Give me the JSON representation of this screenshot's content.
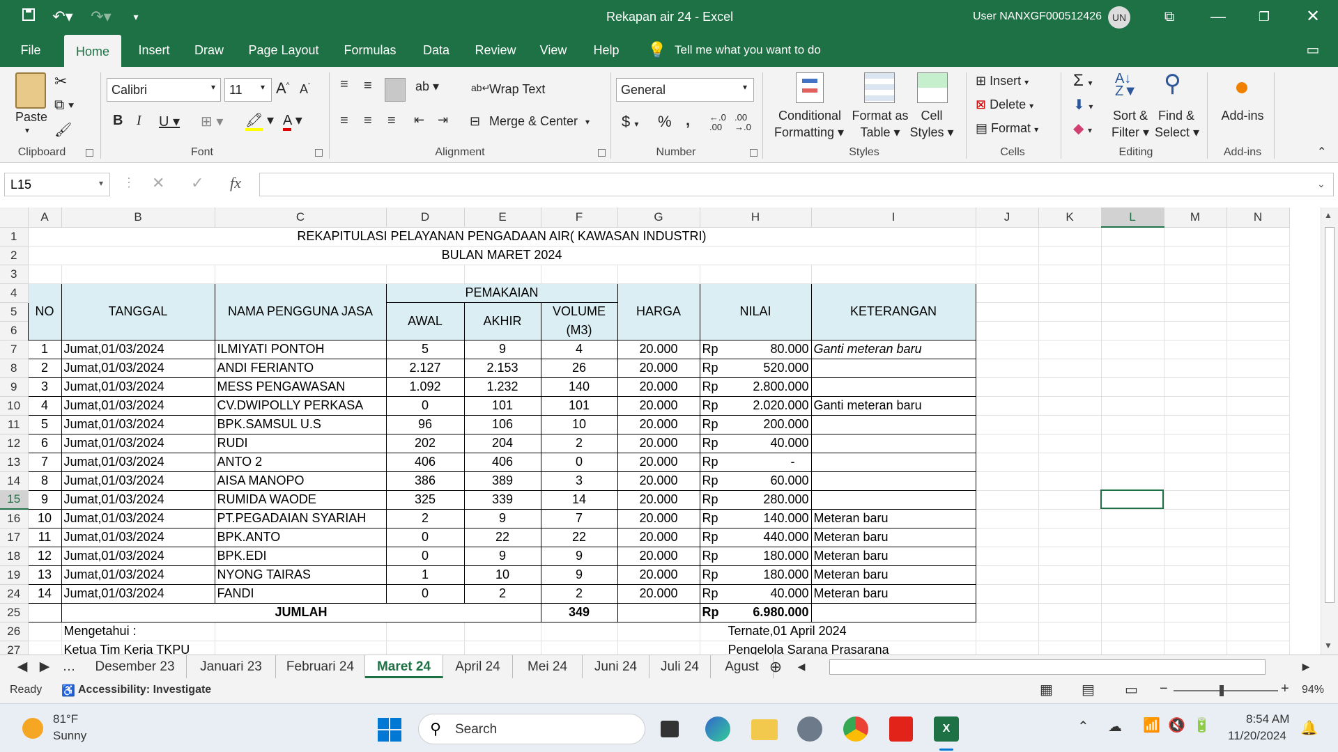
{
  "window": {
    "doc_title": "Rekapan air 24  -  Excel",
    "user": "User NANXGF000512426",
    "user_initials": "UN"
  },
  "tabs": [
    "File",
    "Home",
    "Insert",
    "Draw",
    "Page Layout",
    "Formulas",
    "Data",
    "Review",
    "View",
    "Help"
  ],
  "tell_me": "Tell me what you want to do",
  "ribbon": {
    "paste": "Paste",
    "clipboard": "Clipboard",
    "font_name": "Calibri",
    "font_size": "11",
    "font": "Font",
    "wrap_text": "Wrap Text",
    "merge_center": "Merge & Center",
    "alignment": "Alignment",
    "number_format": "General",
    "number": "Number",
    "conditional_formatting_1": "Conditional",
    "conditional_formatting_2": "Formatting",
    "format_as_table_1": "Format as",
    "format_as_table_2": "Table",
    "cell_styles_1": "Cell",
    "cell_styles_2": "Styles",
    "styles": "Styles",
    "insert": "Insert",
    "delete": "Delete",
    "format": "Format",
    "cells": "Cells",
    "sort_filter_1": "Sort &",
    "sort_filter_2": "Filter",
    "find_select_1": "Find &",
    "find_select_2": "Select",
    "editing": "Editing",
    "addins": "Add-ins",
    "addins_group": "Add-ins"
  },
  "formula_bar": {
    "name_box": "L15",
    "formula": ""
  },
  "columns": [
    "A",
    "B",
    "C",
    "D",
    "E",
    "F",
    "G",
    "H",
    "I",
    "J",
    "K",
    "L",
    "M",
    "N"
  ],
  "sheet": {
    "title": "REKAPITULASI PELAYANAN PENGADAAN AIR( KAWASAN INDUSTRI)",
    "subtitle": "BULAN MARET 2024",
    "headers": {
      "no": "NO",
      "tanggal": "TANGGAL",
      "nama": "NAMA PENGGUNA JASA",
      "pemakaian": "PEMAKAIAN",
      "awal": "AWAL",
      "akhir": "AKHIR",
      "volume": "VOLUME",
      "volume_unit": "(M3)",
      "harga": "HARGA",
      "nilai": "NILAI",
      "keterangan": "KETERANGAN"
    },
    "rows": [
      {
        "row": "7",
        "no": "1",
        "tanggal": "Jumat,01/03/2024",
        "nama": "ILMIYATI PONTOH",
        "awal": "5",
        "akhir": "9",
        "volume": "4",
        "harga": "20.000",
        "rp": "Rp",
        "nilai": "80.000",
        "ket": "Ganti meteran baru",
        "ket_italic": true
      },
      {
        "row": "8",
        "no": "2",
        "tanggal": "Jumat,01/03/2024",
        "nama": "ANDI FERIANTO",
        "awal": "2.127",
        "akhir": "2.153",
        "volume": "26",
        "harga": "20.000",
        "rp": "Rp",
        "nilai": "520.000",
        "ket": ""
      },
      {
        "row": "9",
        "no": "3",
        "tanggal": "Jumat,01/03/2024",
        "nama": "MESS PENGAWASAN",
        "awal": "1.092",
        "akhir": "1.232",
        "volume": "140",
        "harga": "20.000",
        "rp": "Rp",
        "nilai": "2.800.000",
        "ket": ""
      },
      {
        "row": "10",
        "no": "4",
        "tanggal": "Jumat,01/03/2024",
        "nama": "CV.DWIPOLLY PERKASA",
        "awal": "0",
        "akhir": "101",
        "volume": "101",
        "harga": "20.000",
        "rp": "Rp",
        "nilai": "2.020.000",
        "ket": "Ganti meteran baru"
      },
      {
        "row": "11",
        "no": "5",
        "tanggal": "Jumat,01/03/2024",
        "nama": "BPK.SAMSUL U.S",
        "awal": "96",
        "akhir": "106",
        "volume": "10",
        "harga": "20.000",
        "rp": "Rp",
        "nilai": "200.000",
        "ket": ""
      },
      {
        "row": "12",
        "no": "6",
        "tanggal": "Jumat,01/03/2024",
        "nama": "RUDI",
        "awal": "202",
        "akhir": "204",
        "volume": "2",
        "harga": "20.000",
        "rp": "Rp",
        "nilai": "40.000",
        "ket": ""
      },
      {
        "row": "13",
        "no": "7",
        "tanggal": "Jumat,01/03/2024",
        "nama": "ANTO 2",
        "awal": "406",
        "akhir": "406",
        "volume": "0",
        "harga": "20.000",
        "rp": "Rp",
        "nilai": "-",
        "ket": ""
      },
      {
        "row": "14",
        "no": "8",
        "tanggal": "Jumat,01/03/2024",
        "nama": "AISA MANOPO",
        "awal": "386",
        "akhir": "389",
        "volume": "3",
        "harga": "20.000",
        "rp": "Rp",
        "nilai": "60.000",
        "ket": ""
      },
      {
        "row": "15",
        "no": "9",
        "tanggal": "Jumat,01/03/2024",
        "nama": "RUMIDA WAODE",
        "awal": "325",
        "akhir": "339",
        "volume": "14",
        "harga": "20.000",
        "rp": "Rp",
        "nilai": "280.000",
        "ket": ""
      },
      {
        "row": "16",
        "no": "10",
        "tanggal": "Jumat,01/03/2024",
        "nama": "PT.PEGADAIAN SYARIAH",
        "awal": "2",
        "akhir": "9",
        "volume": "7",
        "harga": "20.000",
        "rp": "Rp",
        "nilai": "140.000",
        "ket": "Meteran baru"
      },
      {
        "row": "17",
        "no": "11",
        "tanggal": "Jumat,01/03/2024",
        "nama": "BPK.ANTO",
        "awal": "0",
        "akhir": "22",
        "volume": "22",
        "harga": "20.000",
        "rp": "Rp",
        "nilai": "440.000",
        "ket": "Meteran baru"
      },
      {
        "row": "18",
        "no": "12",
        "tanggal": "Jumat,01/03/2024",
        "nama": "BPK.EDI",
        "awal": "0",
        "akhir": "9",
        "volume": "9",
        "harga": "20.000",
        "rp": "Rp",
        "nilai": "180.000",
        "ket": "Meteran baru"
      },
      {
        "row": "19",
        "no": "13",
        "tanggal": "Jumat,01/03/2024",
        "nama": "NYONG TAIRAS",
        "awal": "1",
        "akhir": "10",
        "volume": "9",
        "harga": "20.000",
        "rp": "Rp",
        "nilai": "180.000",
        "ket": "Meteran baru"
      },
      {
        "row": "24",
        "no": "14",
        "tanggal": "Jumat,01/03/2024",
        "nama": "FANDI",
        "awal": "0",
        "akhir": "2",
        "volume": "2",
        "harga": "20.000",
        "rp": "Rp",
        "nilai": "40.000",
        "ket": "Meteran baru"
      }
    ],
    "total": {
      "row": "25",
      "label": "JUMLAH",
      "volume": "349",
      "rp": "Rp",
      "nilai": "6.980.000"
    },
    "footer": {
      "row26": "26",
      "mengetahui": "Mengetahui :",
      "place_date": "Ternate,01 April 2024",
      "row27": "27",
      "ketua": "Ketua Tim Kerja TKPU",
      "pengelola": "Pengelola Sarana Prasarana"
    },
    "top_rows": [
      "1",
      "2",
      "3",
      "4",
      "5",
      "6"
    ]
  },
  "sheet_tabs": [
    "Desember 23",
    "Januari 23",
    "Februari 24",
    "Maret 24",
    "April 24",
    "Mei 24",
    "Juni 24",
    "Juli 24",
    "Agust"
  ],
  "active_sheet": "Maret 24",
  "status": {
    "ready": "Ready",
    "accessibility": "Accessibility: Investigate",
    "zoom": "94%"
  },
  "taskbar": {
    "temp": "81°F",
    "weather": "Sunny",
    "search": "Search",
    "time": "8:54 AM",
    "date": "11/20/2024"
  },
  "colors": {
    "excel_green": "#1e7145",
    "header_fill": "#daeef3"
  }
}
